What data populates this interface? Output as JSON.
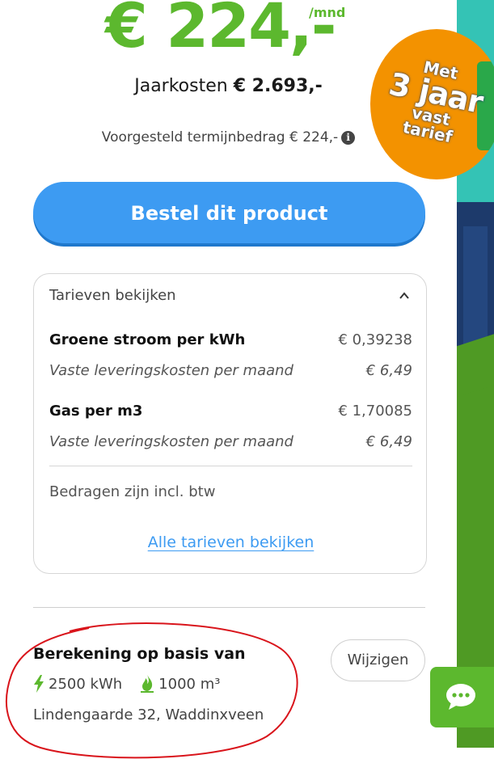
{
  "price": {
    "amount": "€ 224,-",
    "unit": "/mnd"
  },
  "yearly": {
    "label": "Jaarkosten",
    "value": "€ 2.693,-"
  },
  "proposed": {
    "text": "Voorgesteld termijnbedrag € 224,-"
  },
  "badge": {
    "line1": "Met",
    "line2": "3 jaar",
    "line3": "vast",
    "line4": "tarief"
  },
  "order_button": {
    "label": "Bestel dit product"
  },
  "tariffs": {
    "header": "Tarieven bekijken",
    "rows": [
      {
        "label": "Groene stroom per kWh",
        "value": "€ 0,39238"
      },
      {
        "label": "Vaste leveringskosten per maand",
        "value": "€ 6,49"
      },
      {
        "label": "Gas per m3",
        "value": "€ 1,70085"
      },
      {
        "label": "Vaste leveringskosten per maand",
        "value": "€ 6,49"
      }
    ],
    "vat_note": "Bedragen zijn incl. btw",
    "all_link": "Alle tarieven bekijken"
  },
  "calculation": {
    "title": "Berekening op basis van",
    "electricity": "2500 kWh",
    "gas": "1000 m³",
    "address": "Lindengaarde 32, Waddinxveen",
    "change_label": "Wijzigen"
  },
  "colors": {
    "accent_green": "#5cb82e",
    "button_blue": "#3d9bf2",
    "badge_orange": "#f39200",
    "annotation_red": "#d9141b"
  },
  "icons": {
    "info": "info-icon",
    "chevron": "chevron-up-icon",
    "electricity": "lightning-icon",
    "gas": "flame-icon",
    "chat": "chat-icon"
  }
}
